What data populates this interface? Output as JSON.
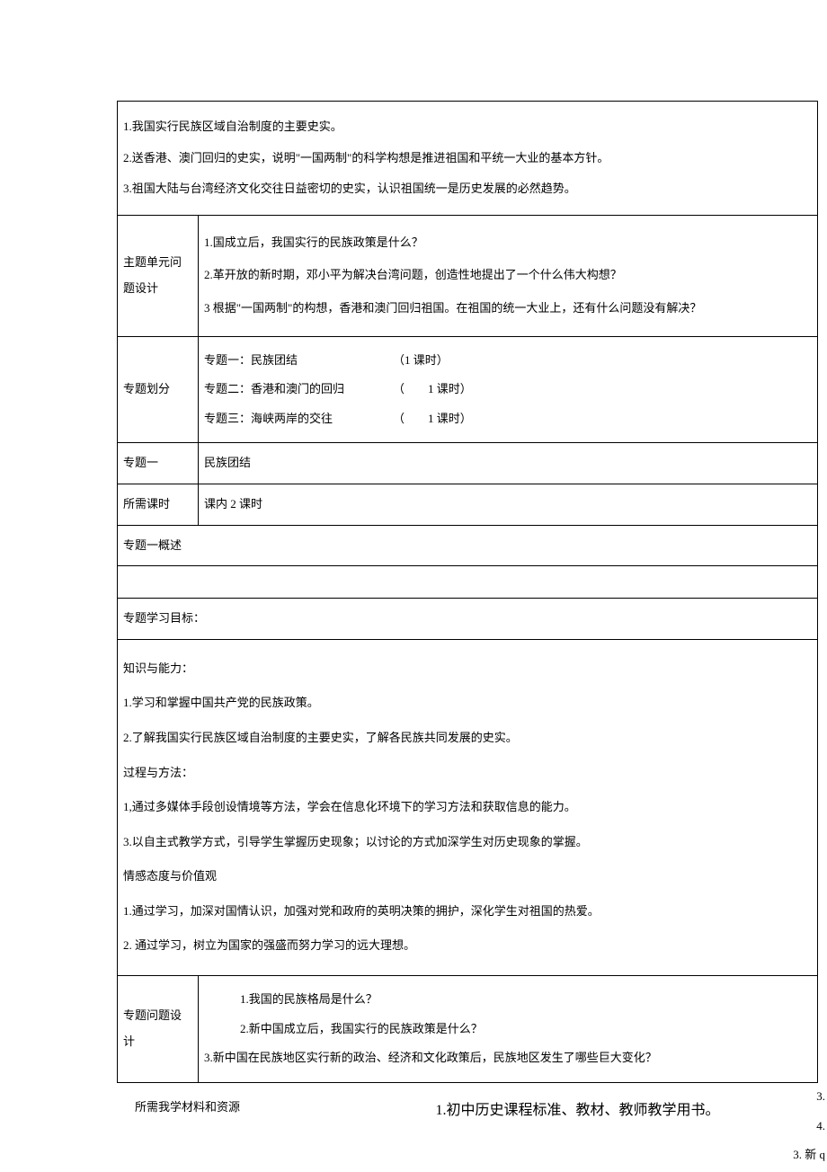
{
  "top_points": {
    "p1": "1.我国实行民族区域自治制度的主要史实。",
    "p2": "2.送香港、澳门回归的史实，说明\"一国两制\"的科学构想是推进祖国和平统一大业的基本方针。",
    "p3": "3.祖国大陆与台湾经济文化交往日益密切的史实，认识祖国统一是历史发展的必然趋势。"
  },
  "unit_questions": {
    "label": "主题单元问题设计",
    "q1": "1.国成立后，我国实行的民族政策是什么？",
    "q2": "2.革开放的新时期，邓小平为解决台湾问题，创造性地提出了一个什么伟大构想？",
    "q3": "3 根据\"一国两制\"的构想，香港和澳门回归祖国。在祖国的统一大业上，还有什么问题没有解决？"
  },
  "topic_division": {
    "label": "专题划分",
    "t1_name": "专题一：民族团结",
    "t1_time": "（1 课时）",
    "t2_name": "专题二：香港和澳门的回归",
    "t2_time": "（　　1 课时）",
    "t3_name": "专题三：海峡两岸的交往",
    "t3_time": "（　　1 课时）"
  },
  "topic_one": {
    "label": "专题一",
    "value": "民族团结"
  },
  "class_hours": {
    "label": "所需课时",
    "value": "课内 2 课时"
  },
  "topic_overview_label": "专题一概述",
  "learning_goals_label": "专题学习目标：",
  "objectives": {
    "knowledge_label": "知识与能力：",
    "k1": "1.学习和掌握中国共产党的民族政策。",
    "k2": "2.了解我国实行民族区域自治制度的主要史实，了解各民族共同发展的史实。",
    "process_label": "过程与方法：",
    "p1": "1,通过多媒体手段创设情境等方法，学会在信息化环境下的学习方法和获取信息的能力。",
    "p2": "3.以自主式教学方式，引导学生掌握历史现象；以讨论的方式加深学生对历史现象的掌握。",
    "emotion_label": "情感态度与价值观",
    "e1": "1.通过学习，加深对国情认识，加强对党和政府的英明决策的拥护，深化学生对祖国的热爱。",
    "e2": "2. 通过学习，树立为国家的强盛而努力学习的远大理想。"
  },
  "topic_questions": {
    "label": "专题问题设计",
    "q1": "1.我国的民族格局是什么？",
    "q2": "2.新中国成立后，我国实行的民族政策是什么？",
    "q3": "3.新中国在民族地区实行新的政治、经济和文化政策后，民族地区发生了哪些巨大变化？"
  },
  "footer": {
    "left": "所需我学材料和资源",
    "right": "1.初中历史课程标准、教材、教师教学用书。"
  },
  "overflow": {
    "l1": "3.",
    "l2": "4.",
    "l3": "3. 新 q"
  }
}
